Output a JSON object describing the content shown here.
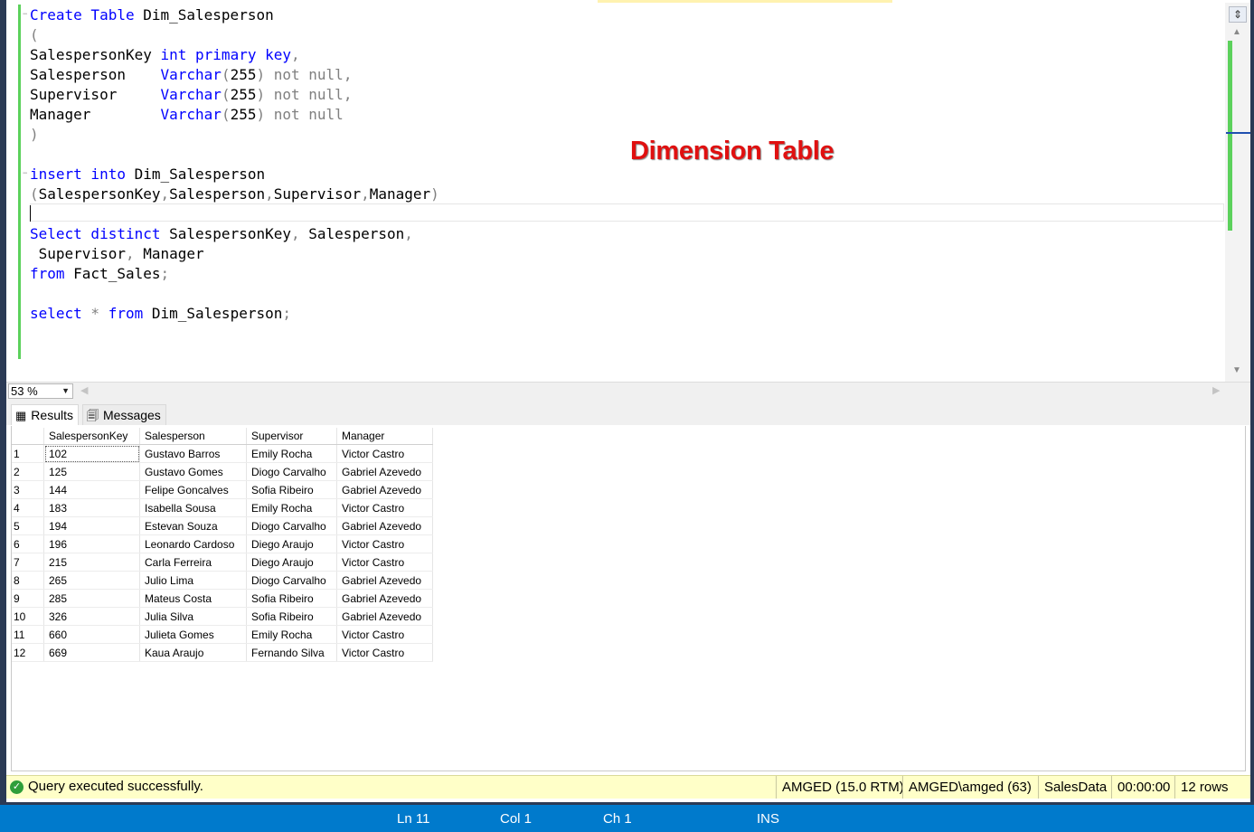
{
  "editor": {
    "title_overlay": "Dimension Table",
    "lines": [
      [
        {
          "t": "Create Table",
          "c": "kw"
        },
        {
          "t": " Dim_Salesperson",
          "c": ""
        }
      ],
      [
        {
          "t": "(",
          "c": "gr"
        }
      ],
      [
        {
          "t": "SalespersonKey ",
          "c": ""
        },
        {
          "t": "int primary key",
          "c": "kw"
        },
        {
          "t": ",",
          "c": "gr"
        }
      ],
      [
        {
          "t": "Salesperson    ",
          "c": ""
        },
        {
          "t": "Varchar",
          "c": "kw"
        },
        {
          "t": "(",
          "c": "gr"
        },
        {
          "t": "255",
          "c": ""
        },
        {
          "t": ") not null,",
          "c": "gr"
        }
      ],
      [
        {
          "t": "Supervisor     ",
          "c": ""
        },
        {
          "t": "Varchar",
          "c": "kw"
        },
        {
          "t": "(",
          "c": "gr"
        },
        {
          "t": "255",
          "c": ""
        },
        {
          "t": ") not null,",
          "c": "gr"
        }
      ],
      [
        {
          "t": "Manager        ",
          "c": ""
        },
        {
          "t": "Varchar",
          "c": "kw"
        },
        {
          "t": "(",
          "c": "gr"
        },
        {
          "t": "255",
          "c": ""
        },
        {
          "t": ") not null",
          "c": "gr"
        }
      ],
      [
        {
          "t": ")",
          "c": "gr"
        }
      ],
      [],
      [
        {
          "t": "insert into",
          "c": "kw"
        },
        {
          "t": " Dim_Salesperson",
          "c": ""
        }
      ],
      [
        {
          "t": "(",
          "c": "gr"
        },
        {
          "t": "SalespersonKey",
          "c": ""
        },
        {
          "t": ",",
          "c": "gr"
        },
        {
          "t": "Salesperson",
          "c": ""
        },
        {
          "t": ",",
          "c": "gr"
        },
        {
          "t": "Supervisor",
          "c": ""
        },
        {
          "t": ",",
          "c": "gr"
        },
        {
          "t": "Manager",
          "c": ""
        },
        {
          "t": ")",
          "c": "gr"
        }
      ],
      [],
      [
        {
          "t": "Select distinct",
          "c": "kw"
        },
        {
          "t": " SalespersonKey",
          "c": ""
        },
        {
          "t": ",",
          "c": "gr"
        },
        {
          "t": " Salesperson",
          "c": ""
        },
        {
          "t": ",",
          "c": "gr"
        }
      ],
      [
        {
          "t": " Supervisor",
          "c": ""
        },
        {
          "t": ",",
          "c": "gr"
        },
        {
          "t": " Manager",
          "c": ""
        }
      ],
      [
        {
          "t": "from",
          "c": "kw"
        },
        {
          "t": " Fact_Sales",
          "c": ""
        },
        {
          "t": ";",
          "c": "gr"
        }
      ],
      [],
      [
        {
          "t": "select",
          "c": "kw"
        },
        {
          "t": " * ",
          "c": "gr"
        },
        {
          "t": "from",
          "c": "kw"
        },
        {
          "t": " Dim_Salesperson",
          "c": ""
        },
        {
          "t": ";",
          "c": "gr"
        }
      ]
    ]
  },
  "zoom": {
    "value": "53 %"
  },
  "tabs": {
    "results": "Results",
    "messages": "Messages"
  },
  "grid": {
    "columns": [
      "SalespersonKey",
      "Salesperson",
      "Supervisor",
      "Manager"
    ],
    "rows": [
      [
        "1",
        "102",
        "Gustavo Barros",
        "Emily Rocha",
        "Victor Castro"
      ],
      [
        "2",
        "125",
        "Gustavo Gomes",
        "Diogo Carvalho",
        "Gabriel Azevedo"
      ],
      [
        "3",
        "144",
        "Felipe Goncalves",
        "Sofia Ribeiro",
        "Gabriel Azevedo"
      ],
      [
        "4",
        "183",
        "Isabella Sousa",
        "Emily Rocha",
        "Victor Castro"
      ],
      [
        "5",
        "194",
        "Estevan Souza",
        "Diogo Carvalho",
        "Gabriel Azevedo"
      ],
      [
        "6",
        "196",
        "Leonardo Cardoso",
        "Diego Araujo",
        "Victor Castro"
      ],
      [
        "7",
        "215",
        "Carla Ferreira",
        "Diego Araujo",
        "Victor Castro"
      ],
      [
        "8",
        "265",
        "Julio Lima",
        "Diogo Carvalho",
        "Gabriel Azevedo"
      ],
      [
        "9",
        "285",
        "Mateus Costa",
        "Sofia Ribeiro",
        "Gabriel Azevedo"
      ],
      [
        "10",
        "326",
        "Julia Silva",
        "Sofia Ribeiro",
        "Gabriel Azevedo"
      ],
      [
        "11",
        "660",
        "Julieta Gomes",
        "Emily Rocha",
        "Victor Castro"
      ],
      [
        "12",
        "669",
        "Kaua Araujo",
        "Fernando Silva",
        "Victor Castro"
      ]
    ]
  },
  "status": {
    "message": "Query executed successfully.",
    "server": "AMGED (15.0 RTM)",
    "user": "AMGED\\amged (63)",
    "database": "SalesData",
    "elapsed": "00:00:00",
    "rows": "12 rows"
  },
  "bottombar": {
    "ln": "Ln 11",
    "col": "Col 1",
    "ch": "Ch 1",
    "mode": "INS"
  },
  "icons": [
    "split-icon",
    "grid-icon",
    "messages-icon",
    "check-icon",
    "dropdown-arrow-icon",
    "scroll-up-icon",
    "scroll-down-icon",
    "scroll-left-icon",
    "scroll-right-icon"
  ]
}
